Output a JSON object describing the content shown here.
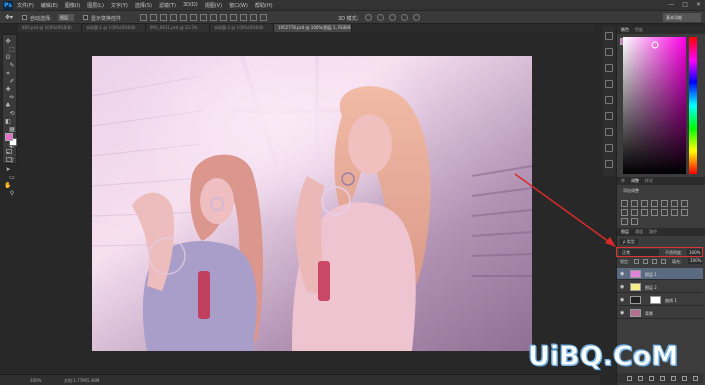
{
  "app": {
    "logo": "Ps"
  },
  "menubar": {
    "items": [
      "文件(F)",
      "编辑(E)",
      "图像(I)",
      "图层(L)",
      "文字(Y)",
      "选择(S)",
      "滤镜(T)",
      "3D(D)",
      "视图(V)",
      "窗口(W)",
      "帮助(H)"
    ],
    "controls": [
      "—",
      "□",
      "✕"
    ]
  },
  "options": {
    "auto_select_label": "自动选择:",
    "auto_select_value": "图层",
    "transform_label": "显示变换控件",
    "mode3d_label": "3D 模式:",
    "workspace": "基本功能"
  },
  "tabs": [
    {
      "label": "800.psd @ 100%(RGB/8)",
      "active": false
    },
    {
      "label": "未标题-1 @ 100%(RGB/8)",
      "active": false
    },
    {
      "label": "IMG_0831.psd @ 33.3%",
      "active": false
    },
    {
      "label": "未标题-2 @ 100%(RGB/8)",
      "active": false
    },
    {
      "label": "1952778.psd @ 100%(图层 1, RGB/8)",
      "active": true
    }
  ],
  "toolbar": {
    "icons": [
      "move-icon",
      "marquee-icon",
      "lasso-icon",
      "quick-select-icon",
      "crop-icon",
      "eyedropper-icon",
      "healing-icon",
      "brush-icon",
      "stamp-icon",
      "history-brush-icon",
      "eraser-icon",
      "gradient-icon",
      "blur-icon",
      "dodge-icon",
      "pen-icon",
      "type-icon",
      "path-select-icon",
      "shape-icon",
      "hand-icon",
      "zoom-icon"
    ],
    "glyphs": [
      "✥",
      "⬚",
      "ʘ",
      "✎",
      "⌗",
      "✐",
      "✚",
      "✏",
      "♣",
      "⟲",
      "◧",
      "▦",
      "●",
      "◐",
      "✒",
      "T",
      "➤",
      "▭",
      "✋",
      "⚲"
    ]
  },
  "colors": {
    "foreground": "#e070c8",
    "background": "#ffffff",
    "canvas_bg": "#282828",
    "accent_red": "#d82a2a"
  },
  "panels": {
    "color_tabs": [
      "颜色",
      "色板"
    ],
    "adjust_tabs": [
      "库",
      "调整",
      "样式"
    ],
    "adjust_title": "添加调整",
    "layers_tabs": [
      "图层",
      "通道",
      "路径"
    ],
    "filter_label": "ρ 类型",
    "blend_mode": "正常",
    "opacity_label": "不透明度:",
    "opacity_value": "100%",
    "lock_label": "锁定:",
    "fill_label": "填充:",
    "fill_value": "100%"
  },
  "layers": [
    {
      "name": "图层 1",
      "selected": true,
      "thumb": "#e283d8"
    },
    {
      "name": "图层 2",
      "selected": false,
      "thumb": "#f5ed8a"
    },
    {
      "name": "曲线 1",
      "selected": false,
      "thumb": "#ffffff",
      "adjust": true
    },
    {
      "name": "背景",
      "selected": false,
      "thumb": "#b07090"
    }
  ],
  "status": {
    "zoom": "100%",
    "doc": "文档:1.77M/5.46M"
  },
  "watermark": "UiBQ.CoM"
}
